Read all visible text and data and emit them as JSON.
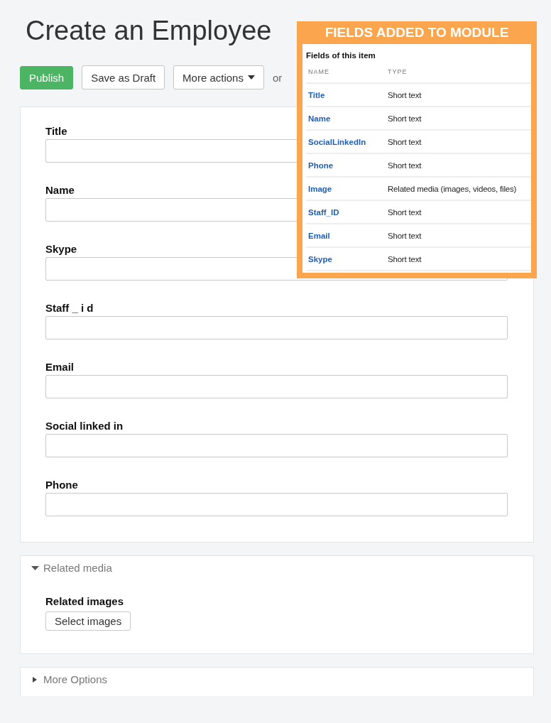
{
  "page_title": "Create an Employee",
  "actions": {
    "publish": "Publish",
    "draft": "Save as Draft",
    "more": "More actions",
    "or": "or"
  },
  "form_fields": [
    {
      "label": "Title"
    },
    {
      "label": "Name"
    },
    {
      "label": "Skype"
    },
    {
      "label": "Staff _ i d"
    },
    {
      "label": "Email"
    },
    {
      "label": "Social linked in"
    },
    {
      "label": "Phone"
    }
  ],
  "panels": [
    {
      "title": "Related media",
      "expanded": true,
      "field_label": "Related images",
      "button": "Select images"
    },
    {
      "title": "More Options",
      "expanded": false
    }
  ],
  "overlay": {
    "banner": "FIELDS ADDED TO MODULE",
    "heading": "Fields of this item",
    "columns": [
      "NAME",
      "TYPE"
    ],
    "rows": [
      {
        "name": "Title",
        "type": "Short text"
      },
      {
        "name": "Name",
        "type": "Short text"
      },
      {
        "name": "SocialLinkedIn",
        "type": "Short text"
      },
      {
        "name": "Phone",
        "type": "Short text"
      },
      {
        "name": "Image",
        "type": "Related media (images, videos, files)"
      },
      {
        "name": "Staff_ID",
        "type": "Short text"
      },
      {
        "name": "Email",
        "type": "Short text"
      },
      {
        "name": "Skype",
        "type": "Short text"
      }
    ]
  }
}
